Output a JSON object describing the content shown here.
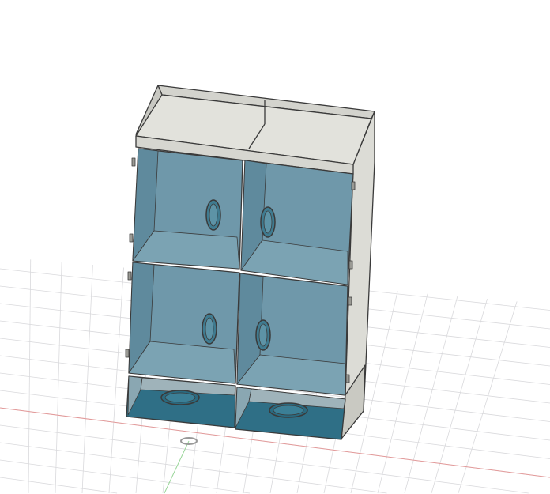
{
  "viewport": {
    "background": "#ffffff",
    "grid_color": "#d9d9dc",
    "x_axis_color": "#e08a8a",
    "y_axis_color": "#8fd08f"
  },
  "model": {
    "body_color": "#dcdcd6",
    "body_shade": "#cfcfc8",
    "glass_color": "#6f98aa",
    "glass_dark": "#4f8296",
    "drawer_color": "#2f6f86",
    "edge_color": "#3a3a3a",
    "door_count": 4,
    "drawer_count": 2
  }
}
